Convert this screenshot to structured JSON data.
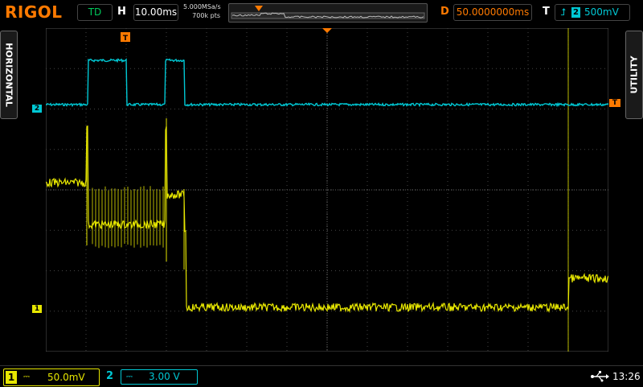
{
  "header": {
    "brand": "RIGOL",
    "run_state": "TD",
    "horizontal_label": "H",
    "timebase": "10.00ms",
    "sample_rate": "5.000MSa/s",
    "memory_depth": "700k pts",
    "delay_label": "D",
    "delay": "50.0000000ms",
    "trigger_label": "T",
    "trigger_source": "2",
    "trigger_level": "500mV"
  },
  "side_tabs": {
    "left": "HORIZONTAL",
    "right": "UTILITY"
  },
  "markers": {
    "ch1": "1",
    "ch2": "2",
    "trigger": "T"
  },
  "footer": {
    "ch1": {
      "number": "1",
      "coupling": "⎓",
      "scale": "50.0mV"
    },
    "ch2": {
      "number": "2",
      "coupling": "⎓",
      "scale": "3.00 V"
    },
    "time": "13:26"
  },
  "colors": {
    "ch1": "#e6e600",
    "ch2": "#00c8d4",
    "accent": "#ff7a00"
  },
  "icons": {
    "usb": "usb-icon",
    "edge": "rising-edge-icon"
  }
}
